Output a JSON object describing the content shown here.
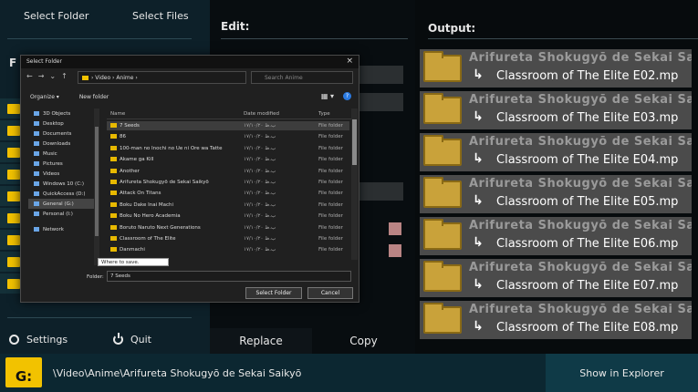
{
  "left": {
    "select_folder": "Select Folder",
    "select_files": "Select Files",
    "section_letter": "F",
    "settings": "Settings",
    "quit": "Quit"
  },
  "edit": {
    "title": "Edit:",
    "replace": "Replace",
    "copy": "Copy"
  },
  "output": {
    "title": "Output:",
    "rows": [
      {
        "src": "Arifureta Shokugyō de Sekai Sai",
        "dst": "Classroom of The Elite E02.mp"
      },
      {
        "src": "Arifureta Shokugyō de Sekai Sai",
        "dst": "Classroom of The Elite E03.mp"
      },
      {
        "src": "Arifureta Shokugyō de Sekai Sai",
        "dst": "Classroom of The Elite E04.mp"
      },
      {
        "src": "Arifureta Shokugyō de Sekai Sai",
        "dst": "Classroom of The Elite E05.mp"
      },
      {
        "src": "Arifureta Shokugyō de Sekai Sai",
        "dst": "Classroom of The Elite E06.mp"
      },
      {
        "src": "Arifureta Shokugyō de Sekai Sai",
        "dst": "Classroom of The Elite E07.mp"
      },
      {
        "src": "Arifureta Shokugyō de Sekai Sai",
        "dst": "Classroom of The Elite E08.mp"
      }
    ]
  },
  "footer": {
    "drive": "G:",
    "path": "\\Video\\Anime\\Arifureta Shokugyō de Sekai Saikyō",
    "show_in_explorer": "Show in Explorer"
  },
  "dialog": {
    "title": "Select Folder",
    "close": "×",
    "address": "› Video › Anime ›",
    "search_placeholder": "Search Anime",
    "organize": "Organize ▾",
    "new_folder": "New folder",
    "view_icon": "▦ ▾",
    "help": "?",
    "tree": [
      "3D Objects",
      "Desktop",
      "Documents",
      "Downloads",
      "Music",
      "Pictures",
      "Videos",
      "Windows 10 (C:)",
      "QuickAccess (D:)",
      "General (G:)",
      "Personal (I:)",
      "Network"
    ],
    "columns": {
      "name": "Name",
      "date": "Date modified",
      "type": "Type"
    },
    "files": [
      {
        "name": "7 Seeds",
        "date": "۱۷/۱۰/۲۰ ب.ظ",
        "type": "File folder"
      },
      {
        "name": "86",
        "date": "۱۷/۱۰/۲۰ ب.ظ",
        "type": "File folder"
      },
      {
        "name": "100-man no Inochi no Ue ni Ore wa Tatte",
        "date": "۱۷/۱۰/۲۰ ب.ظ",
        "type": "File folder"
      },
      {
        "name": "Akame ga Kill",
        "date": "۱۷/۱۰/۲۰ ب.ظ",
        "type": "File folder"
      },
      {
        "name": "Another",
        "date": "۱۷/۱۰/۲۰ ب.ظ",
        "type": "File folder"
      },
      {
        "name": "Arifureta Shokugyō de Sekai Saikyō",
        "date": "۱۷/۱۰/۲۰ ب.ظ",
        "type": "File folder"
      },
      {
        "name": "Attack On Titans",
        "date": "۱۷/۱۰/۲۰ ب.ظ",
        "type": "File folder"
      },
      {
        "name": "Boku Dake Inai Machi",
        "date": "۱۷/۱۰/۲۰ ب.ظ",
        "type": "File folder"
      },
      {
        "name": "Boku No Hero Academia",
        "date": "۱۷/۱۰/۲۰ ب.ظ",
        "type": "File folder"
      },
      {
        "name": "Boruto Naruto Next Generations",
        "date": "۱۷/۱۰/۲۰ ب.ظ",
        "type": "File folder"
      },
      {
        "name": "Classroom of The Elite",
        "date": "۱۷/۱۰/۲۰ ب.ظ",
        "type": "File folder"
      },
      {
        "name": "Danmachi",
        "date": "۱۷/۱۰/۲۰ ب.ظ",
        "type": "File folder"
      }
    ],
    "tooltip": "Where to save.",
    "folder_label": "Folder:",
    "folder_value": "7 Seeds",
    "select_button": "Select Folder",
    "cancel_button": "Cancel"
  }
}
